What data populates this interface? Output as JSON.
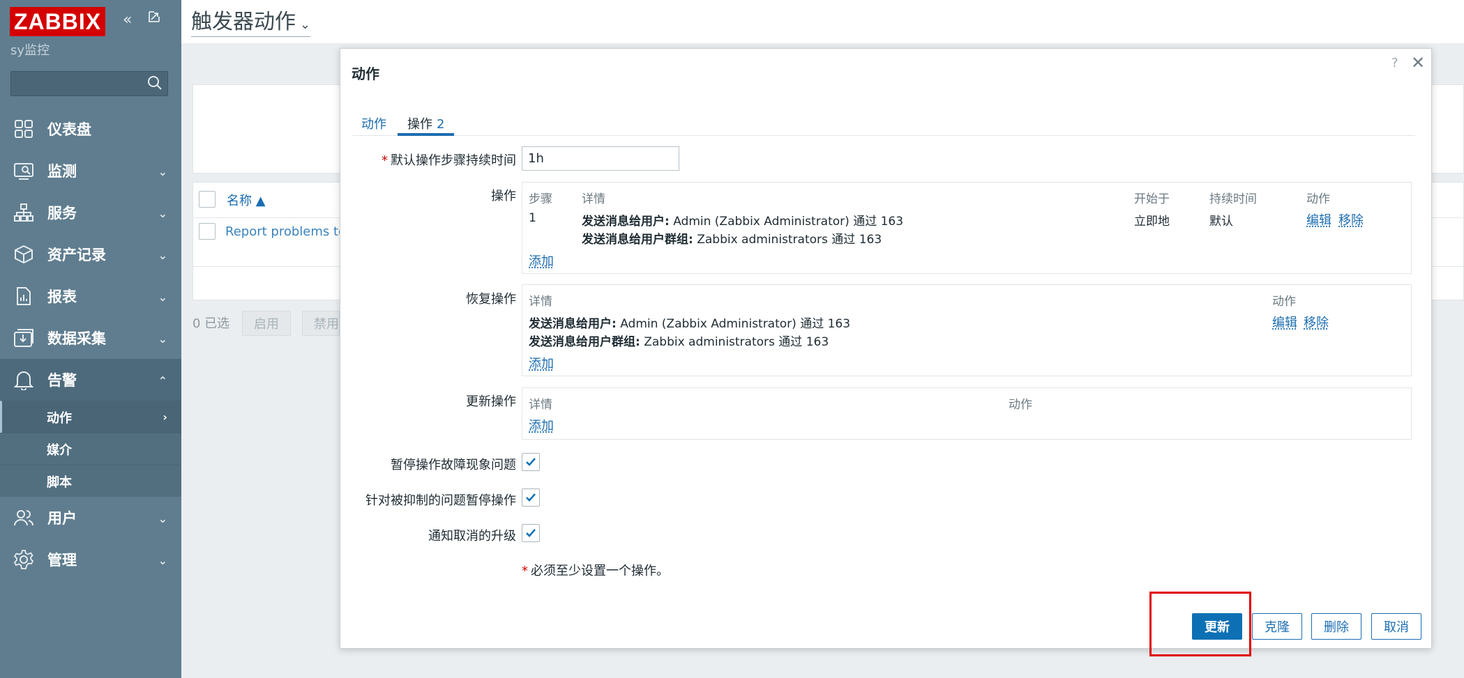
{
  "sidebar": {
    "logo": "ZABBIX",
    "server_name": "sy监控",
    "search_placeholder": "",
    "items": [
      {
        "label": "仪表盘",
        "icon": "dashboard-icon"
      },
      {
        "label": "监测",
        "icon": "monitoring-icon"
      },
      {
        "label": "服务",
        "icon": "services-icon"
      },
      {
        "label": "资产记录",
        "icon": "inventory-icon"
      },
      {
        "label": "报表",
        "icon": "reports-icon"
      },
      {
        "label": "数据采集",
        "icon": "data-collection-icon"
      },
      {
        "label": "告警",
        "icon": "bell-icon"
      },
      {
        "label": "用户",
        "icon": "users-icon"
      },
      {
        "label": "管理",
        "icon": "gear-icon"
      }
    ],
    "alerts_submenu": [
      "动作",
      "媒介",
      "脚本"
    ]
  },
  "main": {
    "title": "触发器动作",
    "list_header": "名称 ▲",
    "list_row": "Report problems to Z",
    "selected_count": "0 已选",
    "bulk_enable": "启用",
    "bulk_disable": "禁用"
  },
  "dialog": {
    "title": "动作",
    "help": "?",
    "tabs": {
      "action": "动作",
      "operations": "操作",
      "operations_count": "2"
    },
    "default_duration_label": "默认操作步骤持续时间",
    "default_duration_value": "1h",
    "operations": {
      "label": "操作",
      "headers": {
        "step": "步骤",
        "details": "详情",
        "start": "开始于",
        "duration": "持续时间",
        "action": "动作"
      },
      "row": {
        "step": "1",
        "detail1_bold": "发送消息给用户:",
        "detail1": " Admin (Zabbix Administrator) 通过 163",
        "detail2_bold": "发送消息给用户群组:",
        "detail2": " Zabbix administrators 通过 163",
        "start": "立即地",
        "duration": "默认",
        "edit": "编辑",
        "remove": "移除"
      },
      "add": "添加"
    },
    "recovery": {
      "label": "恢复操作",
      "headers": {
        "details": "详情",
        "action": "动作"
      },
      "detail1_bold": "发送消息给用户:",
      "detail1": " Admin (Zabbix Administrator) 通过 163",
      "detail2_bold": "发送消息给用户群组:",
      "detail2": " Zabbix administrators 通过 163",
      "edit": "编辑",
      "remove": "移除",
      "add": "添加"
    },
    "update": {
      "label": "更新操作",
      "headers": {
        "details": "详情",
        "action": "动作"
      },
      "add": "添加"
    },
    "pause_symptoms_label": "暂停操作故障现象问题",
    "pause_suppressed_label": "针对被抑制的问题暂停操作",
    "notify_cancelled_label": "通知取消的升级",
    "note": "必须至少设置一个操作。",
    "buttons": {
      "update": "更新",
      "clone": "克隆",
      "delete": "删除",
      "cancel": "取消"
    }
  },
  "colors": {
    "sidebar": "#5f7d8f",
    "accent": "#0d70b5",
    "logo": "#d40000",
    "highlight": "#e00000"
  }
}
